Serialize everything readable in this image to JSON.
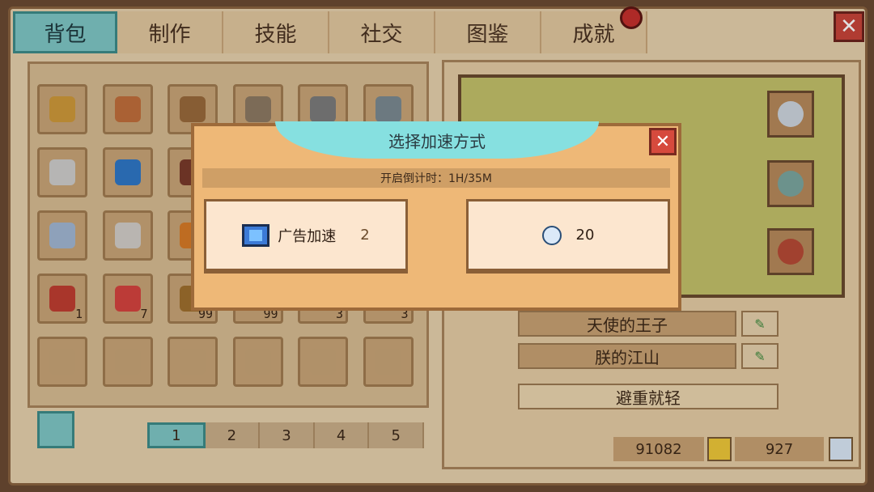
{
  "tabs": [
    "背包",
    "制作",
    "技能",
    "社交",
    "图鉴",
    "成就"
  ],
  "active_tab": "背包",
  "inventory": {
    "slots": [
      {
        "color": "#d09a3b",
        "count": ""
      },
      {
        "color": "#c26f3c",
        "count": ""
      },
      {
        "color": "#9a6a3c",
        "count": ""
      },
      {
        "color": "#8e7a63",
        "count": ""
      },
      {
        "color": "#7d7d7d",
        "count": ""
      },
      {
        "color": "#7c8a92",
        "count": ""
      },
      {
        "color": "#d0cfcd",
        "count": ""
      },
      {
        "color": "#2f78c8",
        "count": ""
      },
      {
        "color": "#7a3b2b",
        "count": ""
      },
      {
        "color": "#c9a678",
        "count": ""
      },
      {
        "color": "#c9a678",
        "count": ""
      },
      {
        "color": "#c9a678",
        "count": ""
      },
      {
        "color": "#a2b8d4",
        "count": ""
      },
      {
        "color": "#d3cfca",
        "count": ""
      },
      {
        "color": "#d97b27",
        "count": ""
      },
      {
        "color": "#c9a678",
        "count": ""
      },
      {
        "color": "#c9a678",
        "count": ""
      },
      {
        "color": "#c9a678",
        "count": ""
      },
      {
        "color": "#c13e32",
        "count": "1"
      },
      {
        "color": "#d7443f",
        "count": "7"
      },
      {
        "color": "#a0702e",
        "count": "99"
      },
      {
        "color": "#c9a678",
        "count": "99"
      },
      {
        "color": "#c9a678",
        "count": "3"
      },
      {
        "color": "#c9a678",
        "count": "3"
      },
      {
        "color": "#c9a678",
        "count": ""
      },
      {
        "color": "#c9a678",
        "count": ""
      },
      {
        "color": "#c9a678",
        "count": ""
      },
      {
        "color": "#c9a678",
        "count": ""
      },
      {
        "color": "#c9a678",
        "count": ""
      },
      {
        "color": "#c9a678",
        "count": ""
      }
    ],
    "pages": [
      "1",
      "2",
      "3",
      "4",
      "5"
    ],
    "active_page": "1"
  },
  "character": {
    "titles": [
      "天使的王子",
      "朕的江山"
    ],
    "footer_label": "避重就轻",
    "gold": "91082",
    "gems": "927"
  },
  "dialog": {
    "title": "选择加速方式",
    "countdown": "开启倒计时：1H/35M",
    "ad_option": {
      "label": "广告加速",
      "count": "2"
    },
    "gem_option": {
      "cost": "20"
    }
  }
}
